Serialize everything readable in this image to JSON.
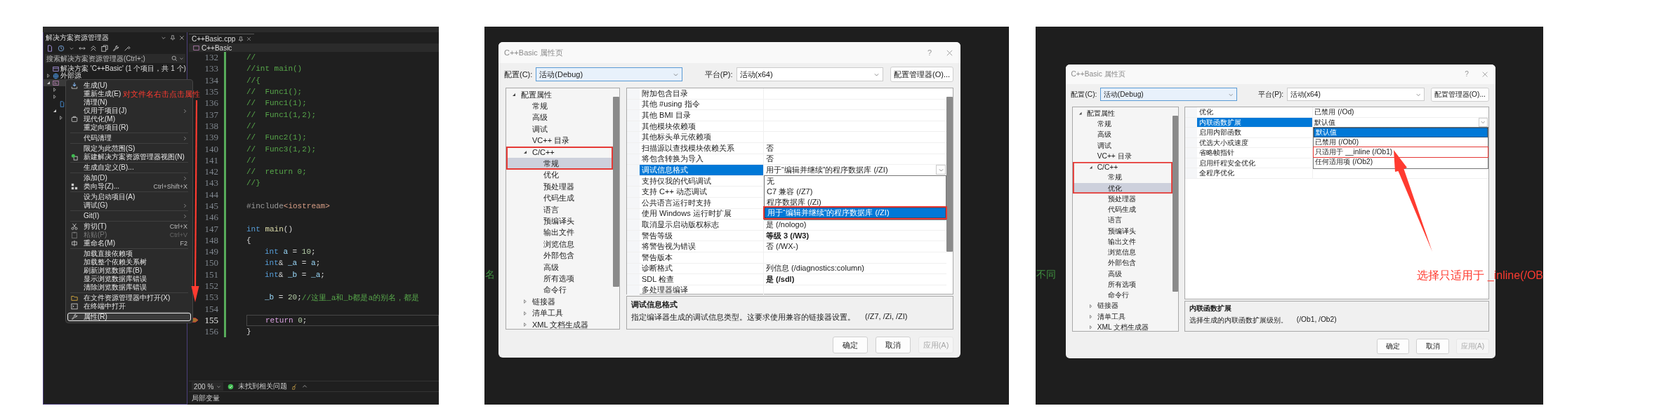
{
  "panels": [
    {
      "kind": "ide",
      "explorer": {
        "title": "解决方案资源管理器",
        "search": {
          "placeholder": "搜索解决方案资源管理器(Ctrl+;)"
        },
        "tree": [
          {
            "label": "解决方案 'C++Basic' (1 个项目，共 1 个)",
            "selected": false
          },
          {
            "label": "外部源",
            "expanded": false,
            "selected": false
          },
          {
            "expanded": true,
            "selected": true,
            "children": [
              {
                "expanded": false,
                "selected": false
              },
              {
                "expanded": false,
                "selected": false
              },
              {
                "selected": false
              },
              {
                "expanded": true,
                "selected": false,
                "children": [
                  {
                    "expanded": false,
                    "selected": false
                  }
                ]
              }
            ]
          }
        ]
      },
      "menu": [
        {
          "kind": "item",
          "label": "生成(U)",
          "submenu": false,
          "disabled": false,
          "selected": false
        },
        {
          "kind": "item",
          "label": "重新生成(E)",
          "submenu": false,
          "disabled": false,
          "selected": false
        },
        {
          "kind": "item",
          "label": "清理(N)",
          "submenu": false,
          "disabled": false,
          "selected": false
        },
        {
          "kind": "item",
          "label": "仅用于项目(J)",
          "submenu": true,
          "disabled": false,
          "selected": false
        },
        {
          "kind": "item",
          "label": "现代化(M)",
          "submenu": false,
          "disabled": false,
          "selected": false
        },
        {
          "kind": "item",
          "label": "重定向项目(R)",
          "submenu": false,
          "disabled": false,
          "selected": false
        },
        {
          "kind": "separator"
        },
        {
          "kind": "item",
          "label": "代码清理",
          "submenu": true,
          "disabled": false,
          "selected": false
        },
        {
          "kind": "separator"
        },
        {
          "kind": "item",
          "label": "限定为此范围(S)",
          "submenu": false,
          "disabled": false,
          "selected": false
        },
        {
          "kind": "item",
          "label": "新建解决方案资源管理器视图(N)",
          "submenu": false,
          "disabled": false,
          "selected": false
        },
        {
          "kind": "separator"
        },
        {
          "kind": "item",
          "label": "生成自定义(B)...",
          "submenu": false,
          "disabled": false,
          "selected": false
        },
        {
          "kind": "separator"
        },
        {
          "kind": "item",
          "label": "添加(D)",
          "submenu": true,
          "disabled": false,
          "selected": false
        },
        {
          "kind": "item",
          "label": "类向导(Z)...",
          "shortcut": "Ctrl+Shift+X",
          "submenu": false,
          "disabled": false,
          "selected": false
        },
        {
          "kind": "separator"
        },
        {
          "kind": "item",
          "label": "设为启动项目(A)",
          "submenu": false,
          "disabled": false,
          "selected": false
        },
        {
          "kind": "item",
          "label": "调试(G)",
          "submenu": true,
          "disabled": false,
          "selected": false
        },
        {
          "kind": "separator"
        },
        {
          "kind": "item",
          "label": "Git(I)",
          "submenu": true,
          "disabled": false,
          "selected": false
        },
        {
          "kind": "separator"
        },
        {
          "kind": "item",
          "label": "剪切(T)",
          "shortcut": "Ctrl+X",
          "submenu": false,
          "disabled": false,
          "selected": false
        },
        {
          "kind": "item",
          "label": "粘贴(P)",
          "shortcut": "Ctrl+V",
          "submenu": false,
          "disabled": true,
          "selected": false
        },
        {
          "kind": "item",
          "label": "重命名(M)",
          "shortcut": "F2",
          "submenu": false,
          "disabled": false,
          "selected": false
        },
        {
          "kind": "separator"
        },
        {
          "kind": "item",
          "label": "加载直接依赖项",
          "submenu": false,
          "disabled": false,
          "selected": false
        },
        {
          "kind": "item",
          "label": "加载整个依赖关系树",
          "submenu": false,
          "disabled": false,
          "selected": false
        },
        {
          "kind": "item",
          "label": "刷新浏览数据库(B)",
          "submenu": false,
          "disabled": false,
          "selected": false
        },
        {
          "kind": "item",
          "label": "显示浏览数据库错误",
          "submenu": false,
          "disabled": false,
          "selected": false
        },
        {
          "kind": "item",
          "label": "清除浏览数据库错误",
          "submenu": false,
          "disabled": false,
          "selected": false
        },
        {
          "kind": "separator"
        },
        {
          "kind": "item",
          "label": "在文件资源管理器中打开(X)",
          "submenu": false,
          "disabled": false,
          "selected": false
        },
        {
          "kind": "item",
          "label": "在终端中打开",
          "submenu": false,
          "disabled": false,
          "selected": false
        },
        {
          "kind": "separator"
        },
        {
          "kind": "item",
          "label": "属性(R)",
          "submenu": false,
          "disabled": false,
          "selected": true
        }
      ],
      "editor": {
        "tab": "C++Basic.cpp",
        "nav": "C++Basic",
        "lines": [
          {
            "number": "132",
            "modified": true,
            "segments": [
              {
                "text": "//",
                "kind": "comment"
              }
            ]
          },
          {
            "number": "133",
            "modified": true,
            "segments": [
              {
                "text": "//int main()",
                "kind": "comment"
              }
            ]
          },
          {
            "number": "134",
            "modified": true,
            "segments": [
              {
                "text": "//{",
                "kind": "comment"
              }
            ]
          },
          {
            "number": "135",
            "modified": true,
            "segments": [
              {
                "text": "//  Func1();",
                "kind": "comment"
              }
            ]
          },
          {
            "number": "136",
            "modified": true,
            "segments": [
              {
                "text": "//  Func1(1);",
                "kind": "comment"
              }
            ]
          },
          {
            "number": "137",
            "modified": true,
            "segments": [
              {
                "text": "//  Func1(1,2);",
                "kind": "comment"
              }
            ]
          },
          {
            "number": "138",
            "modified": true,
            "segments": [
              {
                "text": "//",
                "kind": "comment"
              }
            ]
          },
          {
            "number": "139",
            "modified": true,
            "segments": [
              {
                "text": "//  Func2(1);",
                "kind": "comment"
              }
            ]
          },
          {
            "number": "140",
            "modified": true,
            "segments": [
              {
                "text": "//  Func3(1,2);",
                "kind": "comment"
              }
            ]
          },
          {
            "number": "141",
            "modified": true,
            "segments": [
              {
                "text": "//",
                "kind": "comment"
              }
            ]
          },
          {
            "number": "142",
            "modified": true,
            "segments": [
              {
                "text": "//  return 0;",
                "kind": "comment"
              }
            ]
          },
          {
            "number": "143",
            "modified": true,
            "segments": [
              {
                "text": "//}",
                "kind": "comment"
              }
            ]
          },
          {
            "number": "144",
            "modified": true
          },
          {
            "number": "145",
            "modified": true,
            "segments": [
              {
                "text": "#include",
                "kind": "preproc"
              },
              {
                "text": "<iostream>",
                "kind": "string"
              }
            ]
          },
          {
            "number": "146",
            "modified": true
          },
          {
            "number": "147",
            "modified": true,
            "segments": [
              {
                "text": "int",
                "kind": "keyword"
              },
              {
                "text": " main",
                "kind": "func"
              },
              {
                "text": "()",
                "kind": "plain"
              }
            ]
          },
          {
            "number": "148",
            "modified": true,
            "segments": [
              {
                "text": "{",
                "kind": "plain"
              }
            ]
          },
          {
            "number": "149",
            "modified": true,
            "indented": true,
            "segments": [
              {
                "text": "int",
                "kind": "keyword"
              },
              {
                "text": " a",
                "kind": "ident"
              },
              {
                "text": " = ",
                "kind": "plain"
              },
              {
                "text": "10",
                "kind": "number"
              },
              {
                "text": ";",
                "kind": "plain"
              }
            ]
          },
          {
            "number": "150",
            "modified": true,
            "indented": true,
            "segments": [
              {
                "text": "int",
                "kind": "keyword"
              },
              {
                "text": "& ",
                "kind": "plain"
              },
              {
                "text": "_a",
                "kind": "ident"
              },
              {
                "text": " = ",
                "kind": "plain"
              },
              {
                "text": "a",
                "kind": "ident"
              },
              {
                "text": ";",
                "kind": "plain"
              }
            ]
          },
          {
            "number": "151",
            "modified": true,
            "indented": true,
            "segments": [
              {
                "text": "int",
                "kind": "keyword"
              },
              {
                "text": "& ",
                "kind": "plain"
              },
              {
                "text": "_b",
                "kind": "ident"
              },
              {
                "text": " = ",
                "kind": "plain"
              },
              {
                "text": "_a",
                "kind": "ident"
              },
              {
                "text": ";",
                "kind": "plain"
              }
            ]
          },
          {
            "number": "152",
            "modified": true
          },
          {
            "number": "153",
            "modified": true,
            "indented": true,
            "segments": [
              {
                "text": "_b",
                "kind": "ident"
              },
              {
                "text": " = ",
                "kind": "plain"
              },
              {
                "text": "20",
                "kind": "number"
              },
              {
                "text": ";",
                "kind": "plain"
              },
              {
                "text": "//这里_a和_b都是a的别名，都是",
                "kind": "comment"
              }
            ]
          },
          {
            "number": "154",
            "modified": true
          },
          {
            "number": "155",
            "modified": true,
            "current": true,
            "indented": true,
            "segments": [
              {
                "text": "return",
                "kind": "control"
              },
              {
                "text": " 0",
                "kind": "number"
              },
              {
                "text": ";",
                "kind": "plain"
              }
            ]
          },
          {
            "number": "156",
            "modified": true,
            "segments": [
              {
                "text": "}",
                "kind": "plain"
              }
            ]
          }
        ],
        "zoom": "200 %",
        "status": "未找到相关问题",
        "bottom_tab": "局部变量"
      },
      "annotation": {
        "text": "对文件名右击点击属性"
      }
    },
    {
      "kind": "dialog",
      "background_text": "名",
      "dialog": {
        "title": "C++Basic 属性页",
        "help": "?",
        "config_label": "配置(C):",
        "config": "活动(Debug)",
        "platform_label": "平台(P):",
        "platform": "活动(x64)",
        "manager_button": "配置管理器(O)...",
        "tree": [
          {
            "label": "配置属性",
            "expanded": true,
            "selected": false,
            "children": [
              {
                "label": "常规",
                "selected": false
              },
              {
                "label": "高级",
                "selected": false
              },
              {
                "label": "调试",
                "selected": false
              },
              {
                "label": "VC++ 目录",
                "selected": false
              },
              {
                "label": "C/C++",
                "expanded": true,
                "selected": false,
                "annotated": true,
                "children": [
                  {
                    "label": "常规",
                    "selected": true,
                    "annotated": true
                  },
                  {
                    "label": "优化",
                    "selected": false
                  },
                  {
                    "label": "预处理器",
                    "selected": false
                  },
                  {
                    "label": "代码生成",
                    "selected": false
                  },
                  {
                    "label": "语言",
                    "selected": false
                  },
                  {
                    "label": "预编译头",
                    "selected": false
                  },
                  {
                    "label": "输出文件",
                    "selected": false
                  },
                  {
                    "label": "浏览信息",
                    "selected": false
                  },
                  {
                    "label": "外部包含",
                    "selected": false
                  },
                  {
                    "label": "高级",
                    "selected": false
                  },
                  {
                    "label": "所有选项",
                    "selected": false
                  },
                  {
                    "label": "命令行",
                    "selected": false
                  }
                ]
              },
              {
                "label": "链接器",
                "expanded": false,
                "selected": false
              },
              {
                "label": "清单工具",
                "expanded": false,
                "selected": false
              },
              {
                "label": "XML 文档生成器",
                "expanded": false,
                "selected": false
              }
            ]
          }
        ],
        "grid": [
          {
            "name": "附加包含目录",
            "selected": false
          },
          {
            "name": "其他 #using 指令",
            "selected": false
          },
          {
            "name": "其他 BMI 目录",
            "selected": false
          },
          {
            "name": "其他模块依赖项",
            "selected": false
          },
          {
            "name": "其他标头单元依赖项",
            "selected": false
          },
          {
            "name": "扫描源以查找模块依赖关系",
            "value": "否",
            "selected": false
          },
          {
            "name": "将包含转换为导入",
            "value": "否",
            "selected": false
          },
          {
            "name": "调试信息格式",
            "value": "用于“编辑并继续”的程序数据库 (/ZI)",
            "selected": true,
            "options": [
              {
                "label": "无",
                "selected": false
              },
              {
                "label": "C7 兼容 (/Z7)",
                "selected": false
              },
              {
                "label": "程序数据库 (/Zi)",
                "selected": false
              },
              {
                "label": "用于“编辑并继续”的程序数据库 (/ZI)",
                "selected": true,
                "annotated": true
              }
            ]
          },
          {
            "name": "支持仅我的代码调试",
            "selected": false
          },
          {
            "name": "支持 C++ 动态调试",
            "selected": false
          },
          {
            "name": "公共语言运行时支持",
            "selected": false
          },
          {
            "name": "使用 Windows 运行时扩展",
            "selected": false
          },
          {
            "name": "取消显示启动版权标志",
            "value": "是 (/nologo)",
            "selected": false
          },
          {
            "name": "警告等级",
            "value": "等级 3 (/W3)",
            "bold": true,
            "selected": false
          },
          {
            "name": "将警告视为错误",
            "value": "否 (/WX-)",
            "selected": false
          },
          {
            "name": "警告版本",
            "selected": false
          },
          {
            "name": "诊断格式",
            "value": "列信息 (/diagnostics:column)",
            "selected": false
          },
          {
            "name": "SDL 检查",
            "value": "是 (/sdl)",
            "bold": true,
            "selected": false
          },
          {
            "name": "多处理器编译",
            "selected": false
          }
        ],
        "description": {
          "title": "调试信息格式",
          "text": "指定编译器生成的调试信息类型。这要求使用兼容的链接器设置。",
          "switches": "(/Z7, /Zi, /ZI)"
        },
        "buttons": [
          {
            "label": "确定",
            "disabled": false
          },
          {
            "label": "取消",
            "disabled": false
          },
          {
            "label": "应用(A)",
            "disabled": true
          }
        ]
      }
    },
    {
      "kind": "dialog",
      "background_text": "不同",
      "dialog": {
        "title": "C++Basic 属性页",
        "help": "?",
        "config_label": "配置(C):",
        "config": "活动(Debug)",
        "platform_label": "平台(P):",
        "platform": "活动(x64)",
        "manager_button": "配置管理器(O)...",
        "tree": [
          {
            "label": "配置属性",
            "expanded": true,
            "selected": false,
            "children": [
              {
                "label": "常规",
                "selected": false
              },
              {
                "label": "高级",
                "selected": false
              },
              {
                "label": "调试",
                "selected": false
              },
              {
                "label": "VC++ 目录",
                "selected": false
              },
              {
                "label": "C/C++",
                "expanded": true,
                "selected": false,
                "annotated": true,
                "children": [
                  {
                    "label": "常规",
                    "selected": false,
                    "annotated": true
                  },
                  {
                    "label": "优化",
                    "selected": true,
                    "annotated": true
                  },
                  {
                    "label": "预处理器",
                    "selected": false
                  },
                  {
                    "label": "代码生成",
                    "selected": false
                  },
                  {
                    "label": "语言",
                    "selected": false
                  },
                  {
                    "label": "预编译头",
                    "selected": false
                  },
                  {
                    "label": "输出文件",
                    "selected": false
                  },
                  {
                    "label": "浏览信息",
                    "selected": false
                  },
                  {
                    "label": "外部包含",
                    "selected": false
                  },
                  {
                    "label": "高级",
                    "selected": false
                  },
                  {
                    "label": "所有选项",
                    "selected": false
                  },
                  {
                    "label": "命令行",
                    "selected": false
                  }
                ]
              },
              {
                "label": "链接器",
                "expanded": false,
                "selected": false
              },
              {
                "label": "清单工具",
                "expanded": false,
                "selected": false
              },
              {
                "label": "XML 文档生成器",
                "expanded": false,
                "selected": false
              }
            ]
          }
        ],
        "grid": [
          {
            "name": "优化",
            "value": "已禁用 (/Od)",
            "selected": false
          },
          {
            "name": "内联函数扩展",
            "value": "默认值",
            "selected": true,
            "options": [
              {
                "label": "默认值",
                "selected": true
              },
              {
                "label": "已禁用 (/Ob0)",
                "selected": false
              },
              {
                "label": "只适用于 __inline (/Ob1)",
                "selected": false,
                "annotated": true
              },
              {
                "label": "任何适用项 (/Ob2)",
                "selected": false
              }
            ]
          },
          {
            "name": "启用内部函数",
            "selected": false
          },
          {
            "name": "优选大小或速度",
            "selected": false
          },
          {
            "name": "省略帧指针",
            "selected": false
          },
          {
            "name": "启用纤程安全优化",
            "selected": false
          },
          {
            "name": "全程序优化",
            "selected": false
          }
        ],
        "description": {
          "title": "内联函数扩展",
          "text": "选择生成的内联函数扩展级别。",
          "switches": "(/Ob1, /Ob2)"
        },
        "buttons": [
          {
            "label": "确定",
            "disabled": false
          },
          {
            "label": "取消",
            "disabled": false
          },
          {
            "label": "应用(A)",
            "disabled": true
          }
        ]
      },
      "annotation": {
        "text": "选择只适用于 _inline(/OB"
      }
    }
  ]
}
